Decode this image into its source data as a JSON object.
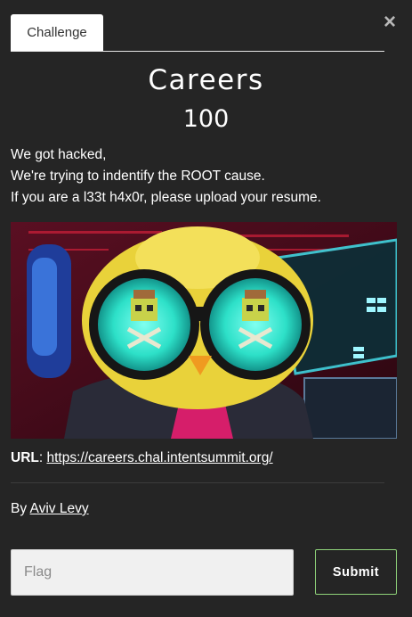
{
  "modal": {
    "close_glyph": "×",
    "tab_label": "Challenge"
  },
  "challenge": {
    "name": "Careers",
    "points": "100",
    "description_lines": [
      "We got hacked,",
      "We're trying to indentify the ROOT cause.",
      "If you are a l33t h4x0r, please upload your resume."
    ],
    "url_label": "URL",
    "url_separator": ":",
    "url": "https://careers.chal.intentsummit.org/",
    "author_prefix": "By",
    "author": "Aviv Levy"
  },
  "form": {
    "flag_placeholder": "Flag",
    "submit_label": "Submit"
  },
  "colors": {
    "background": "#252525",
    "tab_background": "#ffffff",
    "submit_border": "#8fd37a",
    "input_background": "#f0f0f0"
  },
  "icons": {
    "close": "close-icon"
  }
}
